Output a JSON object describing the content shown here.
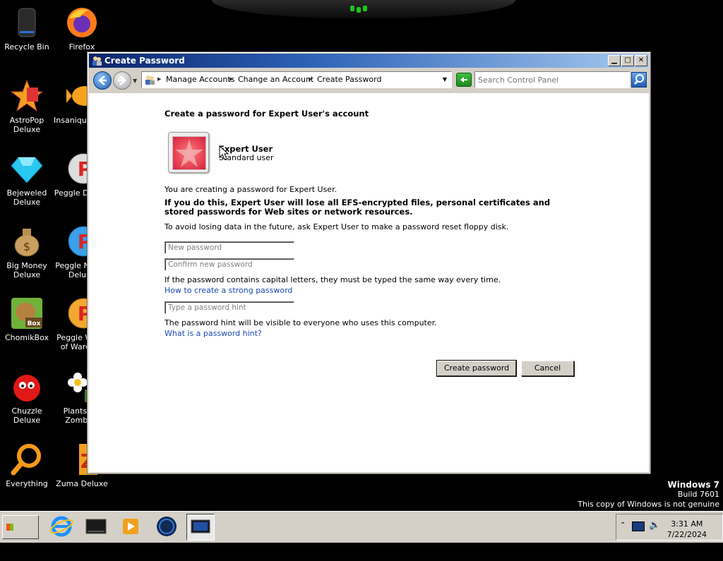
{
  "desktop": {
    "icons": [
      {
        "label": "Recycle Bin"
      },
      {
        "label": "Firefox"
      },
      {
        "label": "AstroPop Deluxe"
      },
      {
        "label": "Insaniquarium Deluxe"
      },
      {
        "label": "Bejeweled Deluxe"
      },
      {
        "label": "Peggle Deluxe"
      },
      {
        "label": "Big Money Deluxe"
      },
      {
        "label": "Peggle Nights Deluxe"
      },
      {
        "label": "ChomikBox"
      },
      {
        "label": "Peggle World of Warcraft"
      },
      {
        "label": "Chuzzle Deluxe"
      },
      {
        "label": "Plants vs. Zombies"
      },
      {
        "label": "Everything"
      },
      {
        "label": "Zuma Deluxe"
      }
    ]
  },
  "window": {
    "title": "Create Password",
    "breadcrumbs": [
      "Manage Accounts",
      "Change an Account",
      "Create Password"
    ],
    "search_placeholder": "Search Control Panel",
    "heading": "Create a password for Expert User's account",
    "user": {
      "name": "Expert User",
      "type": "Standard user"
    },
    "info_line": "You are creating a password for Expert User.",
    "warning": "If you do this, Expert User will lose all EFS-encrypted files, personal certificates and stored passwords for Web sites or network resources.",
    "avoid_line": "To avoid losing data in the future, ask Expert User to make a password reset floppy disk.",
    "fields": {
      "new_password": {
        "placeholder": "New password",
        "value": ""
      },
      "confirm_password": {
        "placeholder": "Confirm new password",
        "value": ""
      },
      "hint": {
        "placeholder": "Type a password hint",
        "value": ""
      }
    },
    "caps_note": "If the password contains capital letters, they must be typed the same way every time.",
    "strong_link": "How to create a strong password",
    "hint_note": "The password hint will be visible to everyone who uses this computer.",
    "hint_link": "What is a password hint?",
    "create_button": "Create password",
    "cancel_button": "Cancel"
  },
  "watermark": {
    "line1": "Windows 7",
    "line2": "Build 7601",
    "line3": "This copy of Windows is not genuine"
  },
  "taskbar": {
    "start_label": "Start",
    "clock_time": "3:31 AM",
    "clock_date": "7/22/2024"
  },
  "colors": {
    "title_gradient_start": "#0a246a",
    "link": "#1a47b0",
    "desktop": "#000000"
  }
}
